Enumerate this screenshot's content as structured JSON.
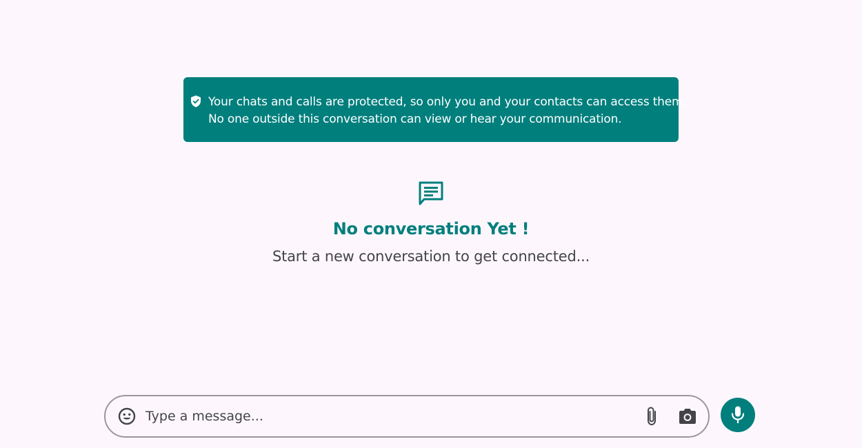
{
  "notice": {
    "icon": "shield-check-icon",
    "line1": "Your chats and calls are protected, so only you and your contacts can access them.",
    "line2": "No one outside this conversation can view or hear your communication.",
    "background": "#017f7d"
  },
  "empty_state": {
    "icon": "chat-bubble-icon",
    "title": "No conversation Yet !",
    "subtitle": "Start a new conversation to get connected..."
  },
  "composer": {
    "placeholder": "Type a message...",
    "value": "",
    "icons": [
      "emoji-icon",
      "paperclip-icon",
      "camera-icon",
      "microphone-icon"
    ]
  },
  "colors": {
    "accent": "#017f7d",
    "page_background": "#fdf7fd",
    "text_muted": "#444446",
    "border": "#9a969c"
  }
}
